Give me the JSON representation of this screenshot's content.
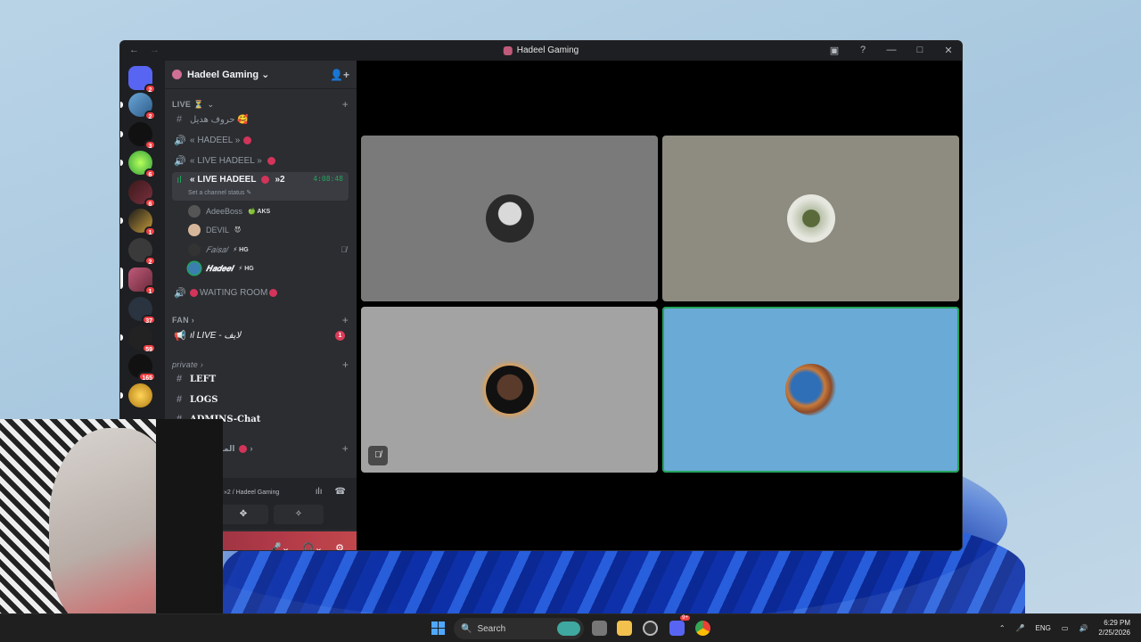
{
  "window": {
    "title": "Hadeel Gaming",
    "nav_back": "←",
    "nav_forward": "→"
  },
  "rail": {
    "badges": [
      "2",
      "2",
      "3",
      "6",
      "6",
      "1",
      "2",
      "1",
      "37",
      "59",
      "165"
    ]
  },
  "sidebar": {
    "server_name": "Hadeel Gaming ⌄",
    "categories": {
      "live": "LIVE ⏳",
      "fan": "FAN ›",
      "private": "private ›",
      "announce": "NCE - المساعدة"
    },
    "channels": {
      "letters": "حروف هديل 🥰",
      "hadeel": "« HADEEL »",
      "live_hadeel_1": "« LIVE HADEEL »",
      "live_hadeel_2": "« LIVE HADEEL",
      "live_hadeel_2_suffix": "»2",
      "live_timer": "4:08:48",
      "channel_status": "Set a channel status ✎",
      "waiting_room": "WAITING ROOM",
      "live_stage": "ıl LIVE - لايف",
      "live_stage_badge": "1",
      "left": "LEFT",
      "logs": "LOGS",
      "admins_chat": "ADMINS-Chat"
    },
    "members": [
      {
        "name": "AdeeBoss",
        "tag": "🍏 AKS"
      },
      {
        "name": "DEVIL",
        "tag": "😈"
      },
      {
        "name": "𝐹𝑎𝑖𝑠𝑎𝑙",
        "tag": "⚡ HG"
      },
      {
        "name": "𝑯𝒂𝒅𝒆𝒆𝒍",
        "tag": "⚡ HG"
      }
    ],
    "voice_panel": {
      "location": "»2 / Hadeel Gaming"
    }
  },
  "taskbar": {
    "search_label": "Search",
    "lang": "ENG",
    "time": "6:29 PM",
    "date": "2/25/2026",
    "discord_badge": "9+"
  },
  "colors": {
    "accent_green": "#23a55a",
    "badge_red": "#f23f43",
    "sidebar_bg": "#2b2d31",
    "rail_bg": "#1e1f22"
  }
}
